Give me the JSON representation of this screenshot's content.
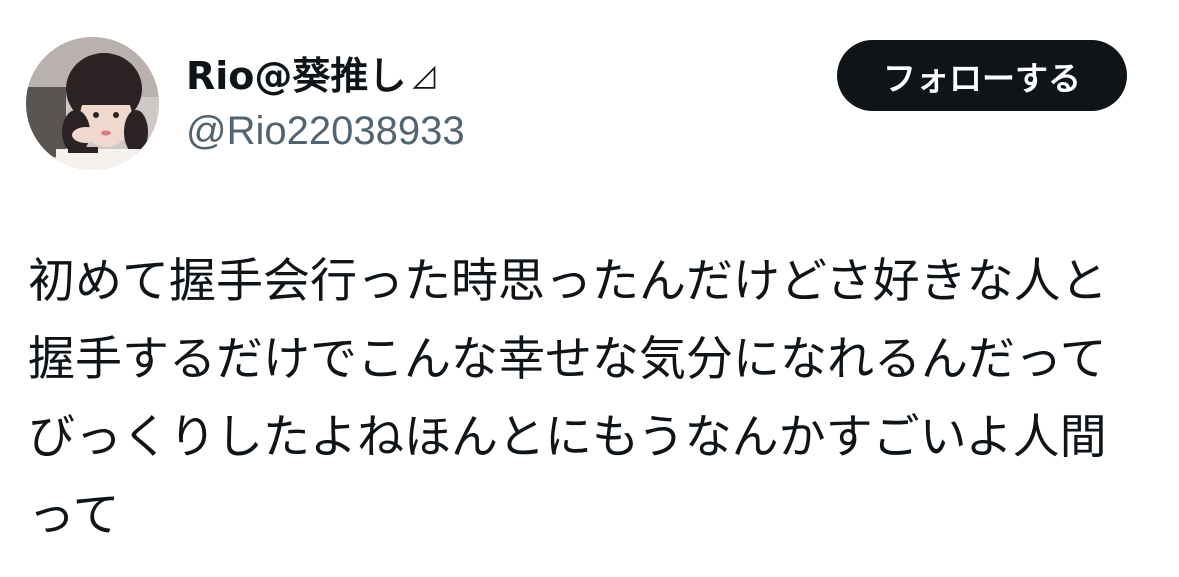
{
  "author": {
    "display_name": "Rio@葵推し",
    "name_mark": "◿",
    "handle": "@Rio22038933"
  },
  "follow_label": "フォローする",
  "tweet_lines": [
    "初めて握手会行った時思ったんだけどさ好きな人と",
    "握手するだけでこんな幸せな気分になれるんだって",
    "びっくりしたよねほんとにもうなんかすごいよ人間",
    "って"
  ],
  "colors": {
    "text": "#0f1419",
    "secondary": "#536471",
    "button_bg": "#0f1419",
    "button_text": "#ffffff"
  }
}
